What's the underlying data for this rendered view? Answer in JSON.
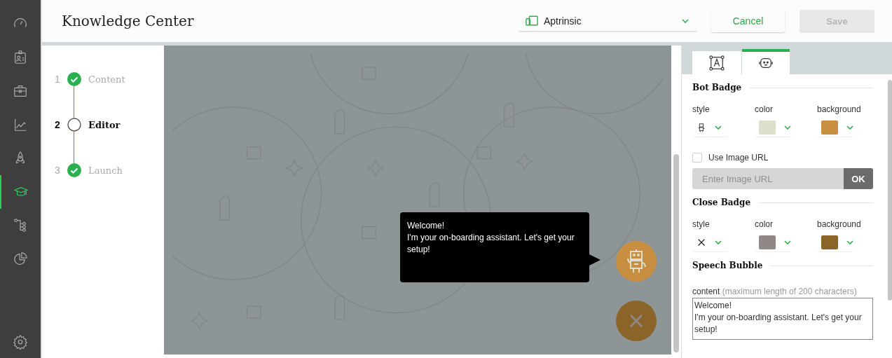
{
  "sidebar": {
    "items": [
      {
        "selected": false
      },
      {
        "selected": false
      },
      {
        "selected": false
      },
      {
        "selected": false
      },
      {
        "selected": false
      },
      {
        "selected": true
      },
      {
        "selected": false
      },
      {
        "selected": false
      }
    ]
  },
  "header": {
    "title": "Knowledge Center",
    "environment": "Aptrinsic",
    "cancel": "Cancel",
    "save": {
      "label": "Save",
      "disabled": true
    }
  },
  "steps": [
    {
      "number": "1",
      "label": "Content",
      "kind": "done"
    },
    {
      "number": "2",
      "label": "Editor",
      "kind": "current"
    },
    {
      "number": "3",
      "label": "Launch",
      "kind": "done"
    }
  ],
  "preview": {
    "bubble_lines": [
      "Welcome!",
      "I'm your on-boarding assistant. Let's get your setup!"
    ]
  },
  "panel": {
    "tabs": [
      {
        "kind": "text",
        "selected": false
      },
      {
        "kind": "bot",
        "selected": true
      }
    ],
    "bot_badge": {
      "title": "Bot Badge",
      "style_label": "style",
      "swatches": [
        {
          "label": "color",
          "color": "#dcdfcc"
        },
        {
          "label": "background",
          "color": "#c98f40"
        }
      ]
    },
    "use_image_url": {
      "label": "Use Image URL",
      "checked": false
    },
    "image_url": {
      "placeholder": "Enter Image URL",
      "button": "OK"
    },
    "close_badge": {
      "title": "Close Badge",
      "style_label": "style",
      "swatches": [
        {
          "label": "color",
          "color": "#908886"
        },
        {
          "label": "background",
          "color": "#8a6428"
        }
      ]
    },
    "speech_bubble": {
      "title": "Speech Bubble",
      "content_label": "content",
      "content_hint": "(maximum length of 200 characters)",
      "content": "Welcome!\nI'm your on-boarding assistant. Let's get your setup!"
    }
  }
}
